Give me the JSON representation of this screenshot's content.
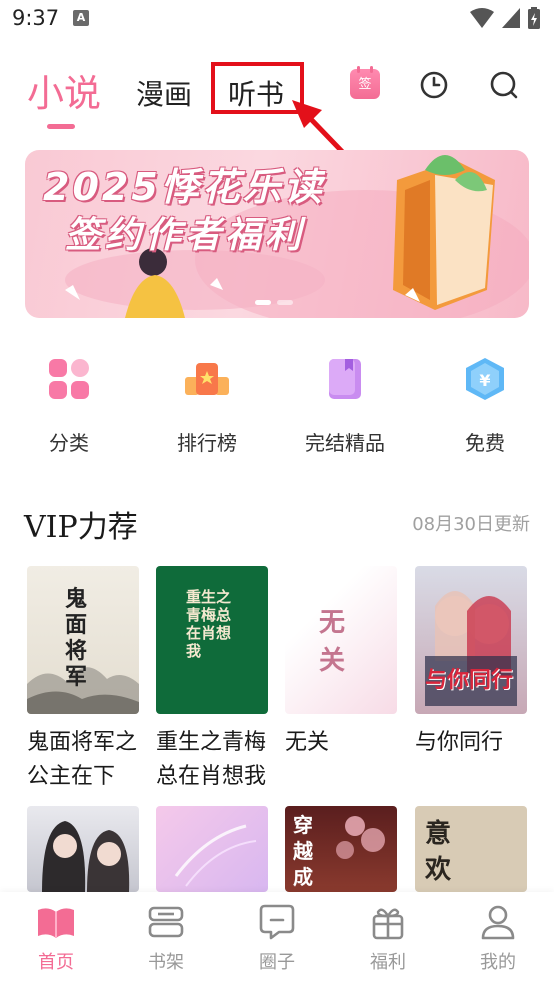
{
  "status_bar": {
    "time": "9:37",
    "notification_badge": "A"
  },
  "top_tabs": {
    "novel": "小说",
    "comic": "漫画",
    "audiobook": "听书"
  },
  "banner": {
    "line1": "2025悸花乐读",
    "line2": "签约作者福利"
  },
  "calendar_icon_text": "签",
  "quick_entries": [
    {
      "label": "分类",
      "icon": "category-icon"
    },
    {
      "label": "排行榜",
      "icon": "ranking-icon"
    },
    {
      "label": "完结精品",
      "icon": "completed-book-icon"
    },
    {
      "label": "免费",
      "icon": "free-icon"
    }
  ],
  "vip_section": {
    "title": "VIP力荐",
    "updated": "08月30日更新",
    "books": [
      {
        "title": "鬼面将军之公主在下",
        "cover_text": "鬼面将军"
      },
      {
        "title": "重生之青梅总在肖想我",
        "cover_text": "重生之青梅总在肖想我"
      },
      {
        "title": "无关",
        "cover_text": "无关"
      },
      {
        "title": "与你同行",
        "cover_text": "与你同行"
      }
    ],
    "books_row2_cover_text": [
      "",
      "",
      "穿越成",
      "意欢"
    ]
  },
  "bottom_nav": [
    {
      "label": "首页",
      "icon": "home-book-icon",
      "active": true
    },
    {
      "label": "书架",
      "icon": "bookshelf-icon",
      "active": false
    },
    {
      "label": "圈子",
      "icon": "chat-bubble-icon",
      "active": false
    },
    {
      "label": "福利",
      "icon": "gift-icon",
      "active": false
    },
    {
      "label": "我的",
      "icon": "profile-icon",
      "active": false
    }
  ],
  "colors": {
    "accent": "#f36c94",
    "highlight_box": "#e3101a",
    "muted": "#999999"
  }
}
